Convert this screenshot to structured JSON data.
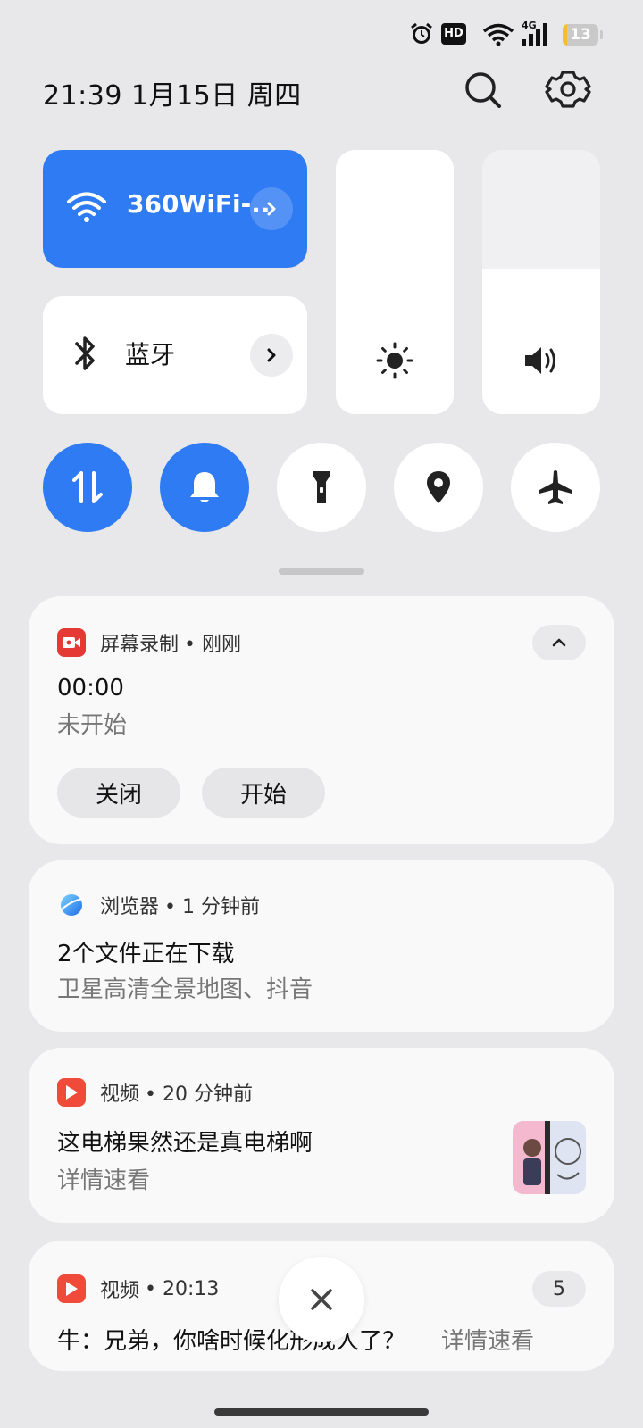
{
  "status_bar": {
    "icons": [
      "alarm-icon",
      "hd-icon",
      "wifi-icon",
      "4g-signal-icon",
      "battery-icon"
    ],
    "hd_label": "HD",
    "network_label": "4G",
    "battery_level": "13",
    "battery_color": "#f4bf2b"
  },
  "header": {
    "datetime": "21:39 1月15日 周四"
  },
  "tiles": {
    "wifi_label": "360WiFi-..",
    "bluetooth_label": "蓝牙"
  },
  "sliders": {
    "brightness_level": 1.0,
    "volume_level": 0.55
  },
  "quick_toggles": [
    {
      "name": "mobile-data-icon",
      "active": true
    },
    {
      "name": "bell-icon",
      "active": true
    },
    {
      "name": "flashlight-icon",
      "active": false
    },
    {
      "name": "location-icon",
      "active": false
    },
    {
      "name": "airplane-icon",
      "active": false
    }
  ],
  "notifications": {
    "screen_record": {
      "app": "屏幕录制",
      "time": "• 刚刚",
      "title": "00:00",
      "subtitle": "未开始",
      "close_label": "关闭",
      "start_label": "开始"
    },
    "browser": {
      "app": "浏览器",
      "time": "• 1 分钟前",
      "title": "2个文件正在下载",
      "subtitle": "卫星高清全景地图、抖音"
    },
    "video1": {
      "app": "视频",
      "time": "• 20 分钟前",
      "title": "这电梯果然还是真电梯啊",
      "subtitle": "详情速看"
    },
    "video2": {
      "app": "视频",
      "time": "• 20:13",
      "count": "5",
      "title": "牛：兄弟，你啥时候化形成人了？",
      "subtitle": "详情速看"
    }
  },
  "colors": {
    "accent": "#2f7bf3",
    "recorder_red": "#e53935",
    "video_red": "#f04b3a"
  }
}
